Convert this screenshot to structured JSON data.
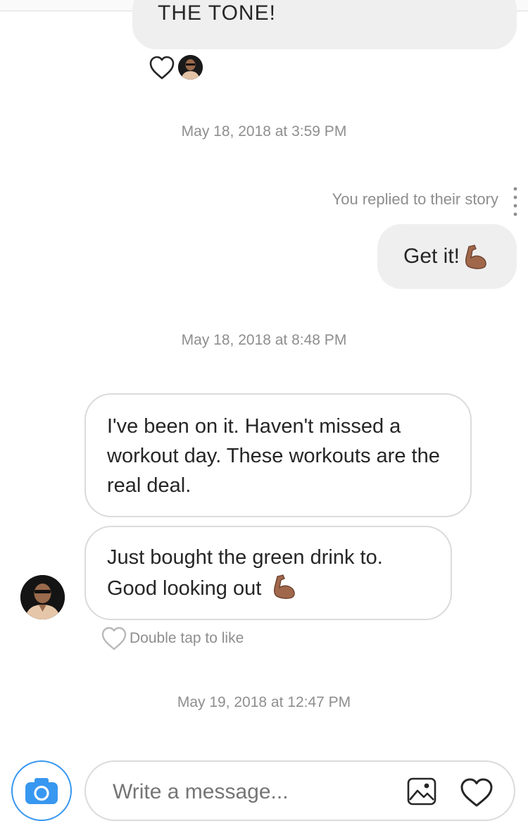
{
  "thread": {
    "top_message_partial": "THE TONE!",
    "timestamps": [
      "May 18, 2018 at 3:59 PM",
      "May 18, 2018 at 8:48 PM",
      "May 19, 2018 at 12:47 PM"
    ],
    "story_reply_label": "You replied to their story",
    "outgoing_message": "Get it!",
    "incoming_messages": [
      "I've been on it. Haven't missed a workout day. These workouts are the real deal.",
      "Just bought the green drink to. Good looking out"
    ],
    "like_hint": "Double tap to like",
    "emoji": "flexed-biceps-medium-dark-skin"
  },
  "composer": {
    "placeholder": "Write a message...",
    "camera_icon": "camera-icon",
    "gallery_icon": "image-icon",
    "heart_icon": "heart-icon"
  },
  "colors": {
    "accent": "#3897f0",
    "bubble_out": "#efefef",
    "bubble_border": "#dbdbdb",
    "meta_text": "#8e8e8e",
    "emoji_skin": "#a0674b"
  }
}
